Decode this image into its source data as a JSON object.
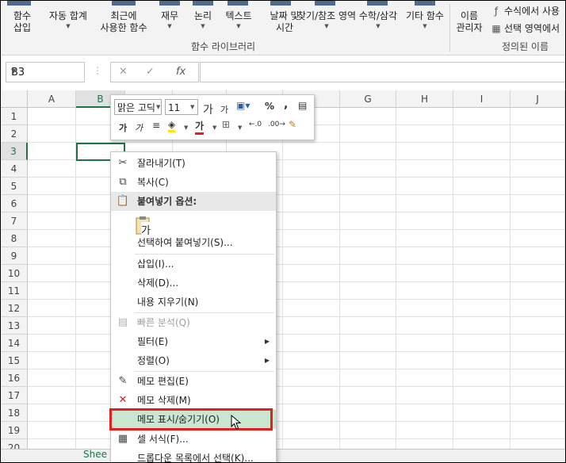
{
  "ribbon": {
    "insert_function": "함수\n삽입",
    "autosum": "자동 합계",
    "recent": "최근에\n사용한 함수",
    "financial": "재무",
    "logical": "논리",
    "text": "텍스트",
    "datetime": "날짜 및\n시간",
    "lookup": "찾기/참조 영역",
    "math": "수학/삼각",
    "more": "기타 함수",
    "name_manager": "이름\n관리자",
    "library_label": "함수 라이브러리",
    "defined_names_label": "정의된 이름",
    "define_from_formula": "수식에서 사용",
    "create_from_selection": "선택 영역에서"
  },
  "formula_bar": {
    "name_box": "B3",
    "cancel_icon": "✕",
    "enter_icon": "✓",
    "fx_icon": "fx",
    "formula": ""
  },
  "grid": {
    "columns": [
      "A",
      "B",
      "C",
      "D",
      "E",
      "F",
      "G",
      "H",
      "I",
      "J"
    ],
    "rows": [
      "1",
      "2",
      "3",
      "4",
      "5",
      "6",
      "7",
      "8",
      "9",
      "10",
      "11",
      "12",
      "13",
      "14",
      "15",
      "16",
      "17",
      "18",
      "19",
      "20"
    ],
    "active_col": "B",
    "active_row": "3",
    "sheet_tab": "Shee"
  },
  "mini_toolbar": {
    "font_name": "맑은 고딕",
    "font_size": "11",
    "grow_font": "가",
    "shrink_font": "가",
    "bold": "가",
    "italic": "가",
    "font_color_glyph": "가",
    "percent": "%",
    "comma": ","
  },
  "context_menu": {
    "cut": "잘라내기(T)",
    "copy": "복사(C)",
    "paste_options": "붙여넣기 옵션:",
    "paste_glyph": "가",
    "paste_special": "선택하여 붙여넣기(S)...",
    "insert": "삽입(I)...",
    "delete": "삭제(D)...",
    "clear": "내용 지우기(N)",
    "quick_analysis": "빠른 분석(Q)",
    "filter": "필터(E)",
    "sort": "정렬(O)",
    "edit_comment": "메모 편집(E)",
    "delete_comment": "메모 삭제(M)",
    "show_hide_comment": "메모 표시/숨기기(O)",
    "format_cells": "셀 서식(F)...",
    "pick_list": "드롭다운 목록에서 선택(K)..."
  },
  "colors": {
    "excel_green": "#217346",
    "highlight": "#c9e6d0",
    "annotation_red": "#e51f1f"
  }
}
